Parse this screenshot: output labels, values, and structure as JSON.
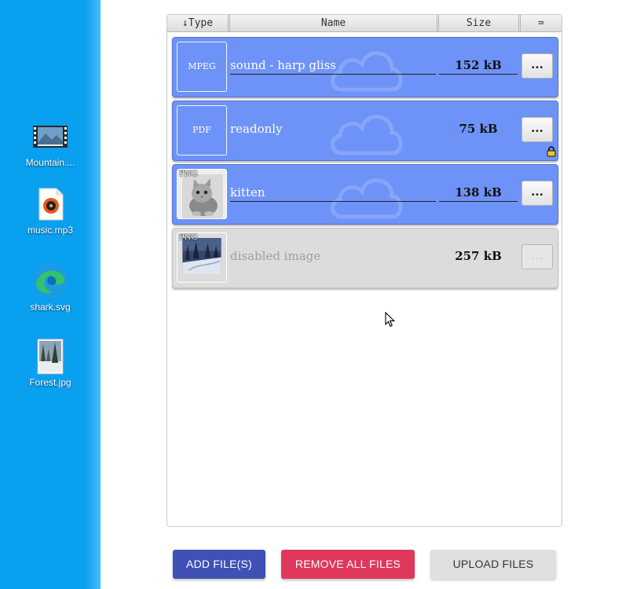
{
  "desktop": {
    "icons": [
      {
        "label": "Mountain....",
        "icon": "video-file-icon"
      },
      {
        "label": "music.mp3",
        "icon": "audio-file-icon"
      },
      {
        "label": "shark.svg",
        "icon": "edge-browser-icon"
      },
      {
        "label": "Forest.jpg",
        "icon": "image-file-icon"
      }
    ]
  },
  "table": {
    "headers": {
      "type": "↓Type",
      "name": "Name",
      "size": "Size",
      "actions": "≃"
    },
    "rows": [
      {
        "ext": "MPEG",
        "name": "sound - harp gliss",
        "size": "152 kB",
        "more": "...",
        "state": "normal"
      },
      {
        "ext": "PDF",
        "name": "readonly",
        "size": "75 kB",
        "more": "...",
        "state": "readonly"
      },
      {
        "ext": "PNG",
        "name": "kitten",
        "size": "138 kB",
        "more": "...",
        "state": "normal"
      },
      {
        "ext": "PNG",
        "name": "disabled image",
        "size": "257 kB",
        "more": "...",
        "state": "disabled"
      }
    ]
  },
  "buttons": {
    "add": "ADD FILE(S)",
    "remove": "REMOVE ALL FILES",
    "upload": "UPLOAD FILES"
  },
  "colors": {
    "desktop_bg": "#0aa0f0",
    "row_active": "#6d93f8",
    "row_disabled": "#dcdcdc",
    "add_button": "#3f51b5",
    "remove_button": "#e0375d",
    "upload_button": "#e0e0e0"
  }
}
